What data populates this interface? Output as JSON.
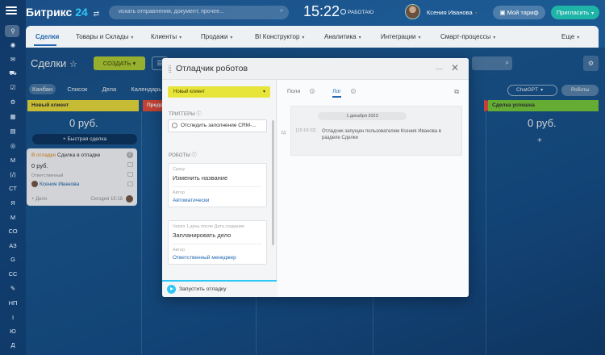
{
  "colors": {
    "accent": "#2066b0",
    "create": "#b7d333",
    "invite": "#1fb4a8",
    "template_select": "#e8e53a",
    "run_accent": "#2fc7f7"
  },
  "rail": {
    "items": [
      "СТ",
      "Я",
      "М",
      "СО",
      "АЗ",
      "G",
      "СС",
      "НП",
      "І",
      "Ю",
      "Д"
    ]
  },
  "topbar": {
    "logo_prefix": "Битрикс",
    "logo_num": "24",
    "search_placeholder": "искать отправления, документ, прочее...",
    "time": "15:22",
    "work_status": "РАБОТАЮ",
    "user_name": "Ксения Иванова",
    "plan_label": "Мой тариф",
    "invite_label": "Пригласить"
  },
  "nav": {
    "items": [
      "Сделки",
      "Товары и Склады",
      "Клиенты",
      "Продажи",
      "BI Конструктор",
      "Аналитика",
      "Интеграции",
      "Смарт-процессы",
      "Еще"
    ]
  },
  "board": {
    "title": "Сделки",
    "create_label": "СОЗДАТЬ",
    "views": [
      "Канбан",
      "Список",
      "Дела",
      "Календарь"
    ],
    "chatgpt_label": "ChatGPT",
    "robots_label": "Роботы",
    "col_new": "Новый клиент",
    "col_next": "Предв",
    "col_success": "Сделка успешна",
    "sum_new": "0 руб.",
    "sum_success": "0 руб.",
    "quick_deal": "+ Быстрая сделка",
    "plus": "+"
  },
  "deal": {
    "status": "В отладке",
    "name": "Сделка в отладке",
    "sum": "0 руб.",
    "resp_label": "Ответственный",
    "resp_name": "Ксения Иванова",
    "task": "+ Дело",
    "date": "Сегодня 15:18",
    "badge": "0"
  },
  "modal": {
    "title": "Отладчик роботов",
    "template": "Новый клиент",
    "triggers_label": "ТРИГГЕРЫ",
    "trigger_text": "Отследить заполнение CRM-...",
    "robots_label": "РОБОТЫ",
    "robot1_cap": "Сразу",
    "robot1_name": "Изменить название",
    "robot1_who_cap": "Автор",
    "robot1_who": "Автоматически",
    "robot2_cap": "Через 1 день после Дата создания",
    "robot2_name": "Запланировать дело",
    "robot2_who_cap": "Автор",
    "robot2_who": "Ответственный менеджер",
    "run_label": "Запустить отладку",
    "tab_fields": "Поля",
    "tab_log": "Лог",
    "log_date": "1 декабря 2023",
    "log_pre": "ЗД",
    "log_time": "[15:18:32]",
    "log_msg": "Отладчик запущен пользователем Ксения Иванова в разделе Сделки"
  }
}
